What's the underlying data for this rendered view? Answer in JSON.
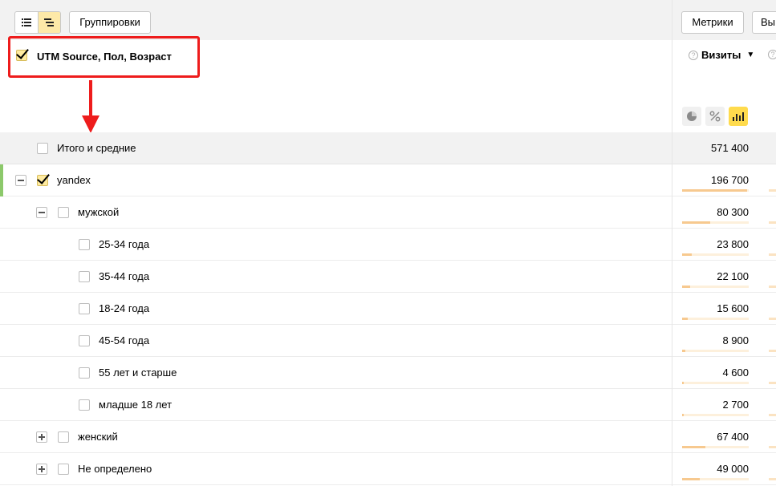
{
  "toolbar": {
    "view_list_icon": "list-icon",
    "view_tree_icon": "tree-icon",
    "groupings_label": "Группировки",
    "metrics_label": "Метрики",
    "cut_label": "Вы"
  },
  "header": {
    "grouping_title": "UTM Source, Пол, Возраст",
    "metric_title": "Визиты",
    "sort_indicator": "▼",
    "help_glyph": "?"
  },
  "display_modes": [
    "pie-chart-icon",
    "percent-icon",
    "bar-chart-icon"
  ],
  "colors": {
    "accent_yellow": "#ffdb4d",
    "checkbox_yellow": "#ffeba0",
    "annotation_red": "#ee1c1c",
    "row_accent_green": "#8cc96b",
    "bar_fill": "#f7c98f"
  },
  "rows": [
    {
      "label": "Итого и средние",
      "value": "571 400",
      "level": 0,
      "toggle": null,
      "checked": false,
      "total": true,
      "share": null
    },
    {
      "label": "yandex",
      "value": "196 700",
      "level": 1,
      "toggle": "minus",
      "checked": true,
      "total": false,
      "share": 0.98
    },
    {
      "label": "мужской",
      "value": "80 300",
      "level": 2,
      "toggle": "minus",
      "checked": false,
      "total": false,
      "share": 0.42
    },
    {
      "label": "25-34 года",
      "value": "23 800",
      "level": 3,
      "toggle": null,
      "checked": false,
      "total": false,
      "share": 0.14
    },
    {
      "label": "35-44 года",
      "value": "22 100",
      "level": 3,
      "toggle": null,
      "checked": false,
      "total": false,
      "share": 0.12
    },
    {
      "label": "18-24 года",
      "value": "15 600",
      "level": 3,
      "toggle": null,
      "checked": false,
      "total": false,
      "share": 0.09
    },
    {
      "label": "45-54 года",
      "value": "8 900",
      "level": 3,
      "toggle": null,
      "checked": false,
      "total": false,
      "share": 0.05
    },
    {
      "label": "55 лет и старше",
      "value": "4 600",
      "level": 3,
      "toggle": null,
      "checked": false,
      "total": false,
      "share": 0.03
    },
    {
      "label": "младше 18 лет",
      "value": "2 700",
      "level": 3,
      "toggle": null,
      "checked": false,
      "total": false,
      "share": 0.02
    },
    {
      "label": "женский",
      "value": "67 400",
      "level": 2,
      "toggle": "plus",
      "checked": false,
      "total": false,
      "share": 0.35
    },
    {
      "label": "Не определено",
      "value": "49 000",
      "level": 2,
      "toggle": "plus",
      "checked": false,
      "total": false,
      "share": 0.26
    }
  ]
}
